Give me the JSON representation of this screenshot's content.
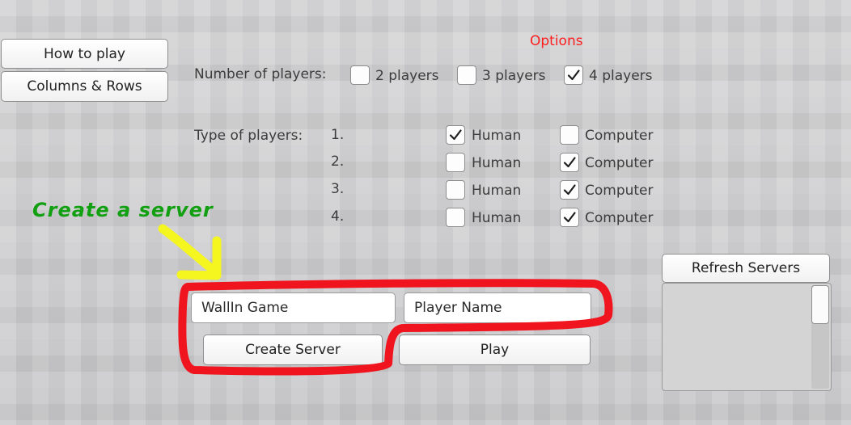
{
  "menu": {
    "how_to_play": "How to play",
    "columns_rows": "Columns & Rows"
  },
  "options": {
    "title": "Options",
    "num_players_label": "Number of players:",
    "num_players": [
      {
        "label": "2 players",
        "checked": false
      },
      {
        "label": "3 players",
        "checked": false
      },
      {
        "label": "4 players",
        "checked": true
      }
    ],
    "type_label": "Type of players:",
    "players": [
      {
        "index": "1.",
        "human_label": "Human",
        "computer_label": "Computer",
        "type": "Human"
      },
      {
        "index": "2.",
        "human_label": "Human",
        "computer_label": "Computer",
        "type": "Computer"
      },
      {
        "index": "3.",
        "human_label": "Human",
        "computer_label": "Computer",
        "type": "Computer"
      },
      {
        "index": "4.",
        "human_label": "Human",
        "computer_label": "Computer",
        "type": "Computer"
      }
    ]
  },
  "annotation": {
    "text": "Create a server",
    "text_color": "#12a012",
    "arrow_color": "#f5f520",
    "highlight_color": "#f0141e"
  },
  "server": {
    "game_name": "WallIn Game",
    "player_name": "Player Name",
    "create_label": "Create Server",
    "play_label": "Play",
    "refresh_label": "Refresh Servers"
  }
}
